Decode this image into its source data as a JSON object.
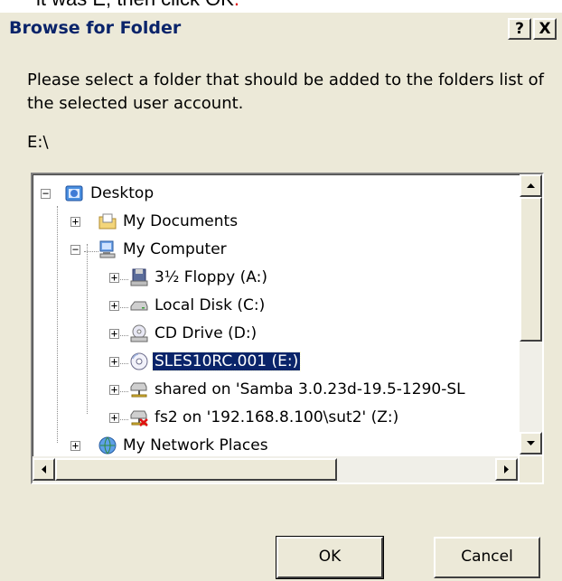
{
  "caption": {
    "text": "it was E, then click OK",
    "period": "."
  },
  "dialog": {
    "title": "Browse for Folder",
    "help_button": "?",
    "close_button": "X",
    "instruction": "Please select a folder that should be added to the folders list of the selected user account.",
    "current_path": "E:\\",
    "ok_label": "OK",
    "cancel_label": "Cancel"
  },
  "tree": {
    "items": [
      {
        "label": "Desktop",
        "icon": "desktop-icon",
        "expander": "−"
      },
      {
        "label": "My Documents",
        "icon": "my-documents-icon",
        "expander": "+"
      },
      {
        "label": "My Computer",
        "icon": "my-computer-icon",
        "expander": "−"
      },
      {
        "label": "3½ Floppy (A:)",
        "icon": "floppy-drive-icon",
        "expander": "+"
      },
      {
        "label": "Local Disk (C:)",
        "icon": "local-disk-icon",
        "expander": "+"
      },
      {
        "label": "CD Drive (D:)",
        "icon": "cd-drive-icon",
        "expander": "+"
      },
      {
        "label": "SLES10RC.001 (E:)",
        "icon": "cd-disc-icon",
        "expander": "+",
        "selected": true
      },
      {
        "label": "shared on 'Samba 3.0.23d-19.5-1290-SL",
        "icon": "network-drive-icon",
        "expander": "+"
      },
      {
        "label": "fs2 on '192.168.8.100\\sut2' (Z:)",
        "icon": "disconnected-network-drive-icon",
        "expander": "+"
      },
      {
        "label": "My Network Places",
        "icon": "network-places-icon",
        "expander": "+"
      }
    ]
  },
  "colors": {
    "dialog_bg": "#ece9d8",
    "title_text": "#0a246a",
    "selection_bg": "#0a246a",
    "caption_period": "#e00000"
  }
}
